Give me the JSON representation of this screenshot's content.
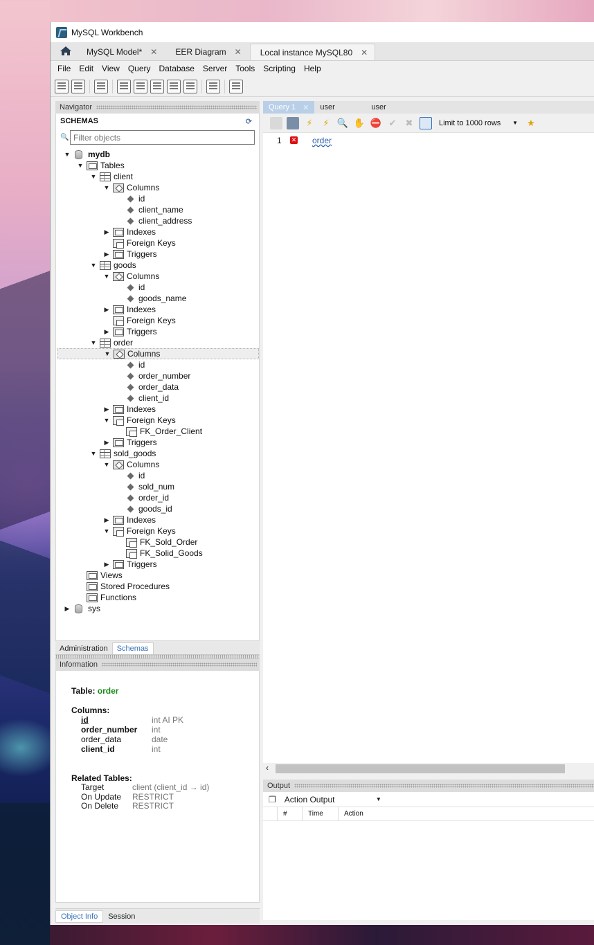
{
  "window": {
    "title": "MySQL Workbench"
  },
  "tabs": [
    {
      "label": "MySQL Model*"
    },
    {
      "label": "EER Diagram"
    },
    {
      "label": "Local instance MySQL80"
    }
  ],
  "menu": [
    "File",
    "Edit",
    "View",
    "Query",
    "Database",
    "Server",
    "Tools",
    "Scripting",
    "Help"
  ],
  "navigator": {
    "title": "Navigator",
    "schemas_title": "SCHEMAS",
    "filter_placeholder": "Filter objects",
    "tree": [
      {
        "label": "mydb",
        "level": 0,
        "icon": "database-icon",
        "twisty": "expanded",
        "bold": true
      },
      {
        "label": "Tables",
        "level": 1,
        "icon": "folder-icon",
        "twisty": "expanded"
      },
      {
        "label": "client",
        "level": 2,
        "icon": "table-icon",
        "twisty": "expanded"
      },
      {
        "label": "Columns",
        "level": 3,
        "icon": "columns-icon",
        "twisty": "expanded"
      },
      {
        "label": "id",
        "level": 4,
        "icon": "column-icon",
        "twisty": "none"
      },
      {
        "label": "client_name",
        "level": 4,
        "icon": "column-icon",
        "twisty": "none"
      },
      {
        "label": "client_address",
        "level": 4,
        "icon": "column-icon",
        "twisty": "none"
      },
      {
        "label": "Indexes",
        "level": 3,
        "icon": "folder-icon",
        "twisty": "collapsed"
      },
      {
        "label": "Foreign Keys",
        "level": 3,
        "icon": "foreign-key-icon",
        "twisty": "none"
      },
      {
        "label": "Triggers",
        "level": 3,
        "icon": "folder-icon",
        "twisty": "collapsed"
      },
      {
        "label": "goods",
        "level": 2,
        "icon": "table-icon",
        "twisty": "expanded"
      },
      {
        "label": "Columns",
        "level": 3,
        "icon": "columns-icon",
        "twisty": "expanded"
      },
      {
        "label": "id",
        "level": 4,
        "icon": "column-icon",
        "twisty": "none"
      },
      {
        "label": "goods_name",
        "level": 4,
        "icon": "column-icon",
        "twisty": "none"
      },
      {
        "label": "Indexes",
        "level": 3,
        "icon": "folder-icon",
        "twisty": "collapsed"
      },
      {
        "label": "Foreign Keys",
        "level": 3,
        "icon": "foreign-key-icon",
        "twisty": "none"
      },
      {
        "label": "Triggers",
        "level": 3,
        "icon": "folder-icon",
        "twisty": "collapsed"
      },
      {
        "label": "order",
        "level": 2,
        "icon": "table-icon",
        "twisty": "expanded"
      },
      {
        "label": "Columns",
        "level": 3,
        "icon": "columns-icon",
        "twisty": "expanded",
        "selected": true
      },
      {
        "label": "id",
        "level": 4,
        "icon": "column-icon",
        "twisty": "none"
      },
      {
        "label": "order_number",
        "level": 4,
        "icon": "column-icon",
        "twisty": "none"
      },
      {
        "label": "order_data",
        "level": 4,
        "icon": "column-icon",
        "twisty": "none"
      },
      {
        "label": "client_id",
        "level": 4,
        "icon": "column-icon",
        "twisty": "none"
      },
      {
        "label": "Indexes",
        "level": 3,
        "icon": "folder-icon",
        "twisty": "collapsed"
      },
      {
        "label": "Foreign Keys",
        "level": 3,
        "icon": "foreign-key-icon",
        "twisty": "expanded"
      },
      {
        "label": "FK_Order_Client",
        "level": 4,
        "icon": "foreign-key-icon",
        "twisty": "none"
      },
      {
        "label": "Triggers",
        "level": 3,
        "icon": "folder-icon",
        "twisty": "collapsed"
      },
      {
        "label": "sold_goods",
        "level": 2,
        "icon": "table-icon",
        "twisty": "expanded"
      },
      {
        "label": "Columns",
        "level": 3,
        "icon": "columns-icon",
        "twisty": "expanded"
      },
      {
        "label": "id",
        "level": 4,
        "icon": "column-icon",
        "twisty": "none"
      },
      {
        "label": "sold_num",
        "level": 4,
        "icon": "column-icon",
        "twisty": "none"
      },
      {
        "label": "order_id",
        "level": 4,
        "icon": "column-icon",
        "twisty": "none"
      },
      {
        "label": "goods_id",
        "level": 4,
        "icon": "column-icon",
        "twisty": "none"
      },
      {
        "label": "Indexes",
        "level": 3,
        "icon": "folder-icon",
        "twisty": "collapsed"
      },
      {
        "label": "Foreign Keys",
        "level": 3,
        "icon": "foreign-key-icon",
        "twisty": "expanded"
      },
      {
        "label": "FK_Sold_Order",
        "level": 4,
        "icon": "foreign-key-icon",
        "twisty": "none"
      },
      {
        "label": "FK_Solid_Goods",
        "level": 4,
        "icon": "foreign-key-icon",
        "twisty": "none"
      },
      {
        "label": "Triggers",
        "level": 3,
        "icon": "folder-icon",
        "twisty": "collapsed"
      },
      {
        "label": "Views",
        "level": 1,
        "icon": "folder-icon",
        "twisty": "none"
      },
      {
        "label": "Stored Procedures",
        "level": 1,
        "icon": "folder-icon",
        "twisty": "none"
      },
      {
        "label": "Functions",
        "level": 1,
        "icon": "folder-icon",
        "twisty": "none"
      },
      {
        "label": "sys",
        "level": 0,
        "icon": "database-icon",
        "twisty": "collapsed"
      }
    ],
    "bottom_tabs": [
      "Administration",
      "Schemas"
    ],
    "active_bottom_tab": "Schemas"
  },
  "information": {
    "title": "Information",
    "table_label": "Table:",
    "table_name": "order",
    "columns_label": "Columns:",
    "columns": [
      {
        "name": "id",
        "type": "int AI PK",
        "bold": true
      },
      {
        "name": "order_number",
        "type": "int",
        "bold": true
      },
      {
        "name": "order_data",
        "type": "date",
        "bold": false
      },
      {
        "name": "client_id",
        "type": "int",
        "bold": true
      }
    ],
    "related_label": "Related Tables:",
    "related": [
      {
        "key": "Target",
        "value": "client (client_id → id)"
      },
      {
        "key": "On Update",
        "value": "RESTRICT"
      },
      {
        "key": "On Delete",
        "value": "RESTRICT"
      }
    ],
    "tabs": [
      "Object Info",
      "Session"
    ],
    "active_tab": "Object Info"
  },
  "query": {
    "tabs": [
      "Query 1",
      "user",
      "user"
    ],
    "limit_label": "Limit to 1000 rows",
    "line_number": "1",
    "code": "order"
  },
  "output": {
    "title": "Output",
    "selector": "Action Output",
    "columns": [
      "#",
      "Time",
      "Action"
    ]
  }
}
